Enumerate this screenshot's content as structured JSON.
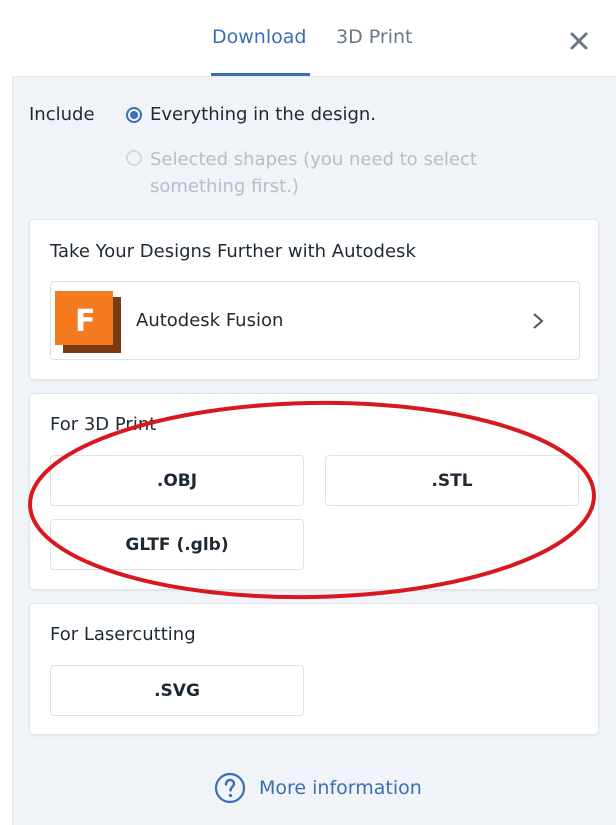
{
  "tabs": {
    "download": "Download",
    "print": "3D Print"
  },
  "include": {
    "label": "Include",
    "option_all": "Everything in the design.",
    "option_selected": "Selected shapes (you need to select something first.)"
  },
  "autodesk": {
    "title": "Take Your Designs Further with Autodesk",
    "app_label": "Autodesk Fusion",
    "logo_letter": "F"
  },
  "print3d": {
    "title": "For 3D Print",
    "buttons": [
      ".OBJ",
      ".STL",
      "GLTF (.glb)"
    ]
  },
  "laser": {
    "title": "For Lasercutting",
    "buttons": [
      ".SVG"
    ]
  },
  "footer": {
    "more_info": "More information"
  },
  "colors": {
    "accent": "#3a6fb5",
    "annotation": "#d7191f",
    "fusion_orange": "#f47b20"
  }
}
